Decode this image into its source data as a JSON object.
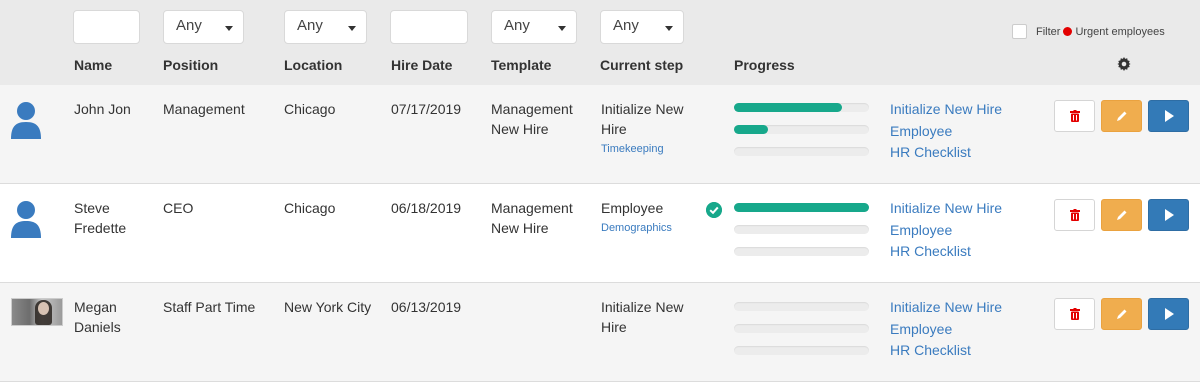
{
  "filters": {
    "name_value": "",
    "position": "Any",
    "location": "Any",
    "hire_date_value": "",
    "template": "Any",
    "current_step": "Any",
    "urgent_label_prefix": "Filter",
    "urgent_label": "Urgent employees",
    "urgent_checked": false
  },
  "columns": {
    "name": "Name",
    "position": "Position",
    "location": "Location",
    "hire_date": "Hire Date",
    "template": "Template",
    "current_step": "Current step",
    "progress": "Progress"
  },
  "colors": {
    "header_bg": "#eaeaea",
    "progress_fill": "#17a88b",
    "link": "#3a7bbf",
    "delete_icon": "#e30000",
    "edit_button": "#f0ad4e",
    "play_button": "#337ab7",
    "avatar": "#3a7bbf"
  },
  "rows": [
    {
      "name_line1": "John Jon",
      "name_line2": "",
      "avatar": "user-icon",
      "position": "Management",
      "location": "Chicago",
      "hire_date": "07/17/2019",
      "template_line1": "Management",
      "template_line2": "New Hire",
      "step_line1": "Initialize New",
      "step_line2": "Hire",
      "step_sub": "Timekeeping",
      "step_complete": false,
      "progress": [
        0.8,
        0.25,
        0
      ],
      "links": [
        "Initialize New Hire",
        "Employee",
        "HR Checklist"
      ]
    },
    {
      "name_line1": "Steve",
      "name_line2": "Fredette",
      "avatar": "user-icon",
      "position": "CEO",
      "location": "Chicago",
      "hire_date": "06/18/2019",
      "template_line1": "Management",
      "template_line2": "New Hire",
      "step_line1": "Employee",
      "step_line2": "",
      "step_sub": "Demographics",
      "step_complete": true,
      "progress": [
        1.0,
        0,
        0
      ],
      "links": [
        "Initialize New Hire",
        "Employee",
        "HR Checklist"
      ]
    },
    {
      "name_line1": "Megan",
      "name_line2": "Daniels",
      "avatar": "photo",
      "position": "Staff Part Time",
      "location": "New York City",
      "hire_date": "06/13/2019",
      "template_line1": "",
      "template_line2": "",
      "step_line1": "Initialize New",
      "step_line2": "Hire",
      "step_sub": "",
      "step_complete": false,
      "progress": [
        0,
        0,
        0
      ],
      "links": [
        "Initialize New Hire",
        "Employee",
        "HR Checklist"
      ]
    }
  ]
}
